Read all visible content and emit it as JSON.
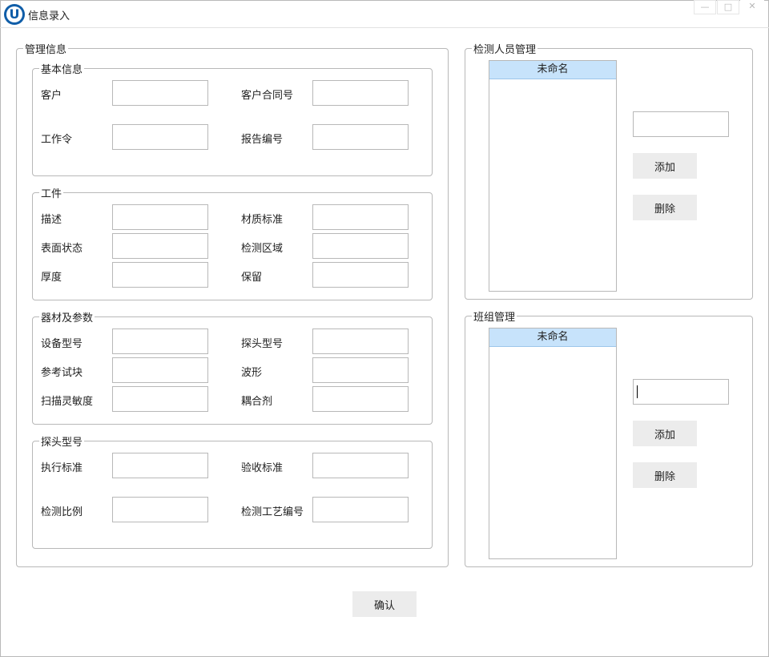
{
  "window": {
    "title": "信息录入",
    "logo_letter": "U",
    "controls": {
      "minimize": "—",
      "maximize": "□",
      "close": "✕"
    }
  },
  "management": {
    "legend": "管理信息",
    "basic": {
      "legend": "基本信息",
      "customer": "客户",
      "contract_no": "客户合同号",
      "work_order": "工作令",
      "report_no": "报告编号"
    },
    "workpiece": {
      "legend": "工件",
      "description": "描述",
      "material_std": "材质标准",
      "surface_state": "表面状态",
      "inspect_area": "检测区域",
      "thickness": "厚度",
      "reserved": "保留"
    },
    "equipment": {
      "legend": "器材及参数",
      "device_model": "设备型号",
      "probe_model": "探头型号",
      "ref_block": "参考试块",
      "waveform": "波形",
      "scan_sensitivity": "扫描灵敏度",
      "couplant": "耦合剂"
    },
    "probe": {
      "legend": "探头型号",
      "exec_std": "执行标准",
      "accept_std": "验收标准",
      "inspect_ratio": "检测比例",
      "process_no": "检测工艺编号"
    }
  },
  "inspectors": {
    "legend": "检测人员管理",
    "list_header": "未命名",
    "input_value": "",
    "add": "添加",
    "delete": "删除"
  },
  "teams": {
    "legend": "班组管理",
    "list_header": "未命名",
    "input_value": "",
    "add": "添加",
    "delete": "删除"
  },
  "confirm": "确认"
}
